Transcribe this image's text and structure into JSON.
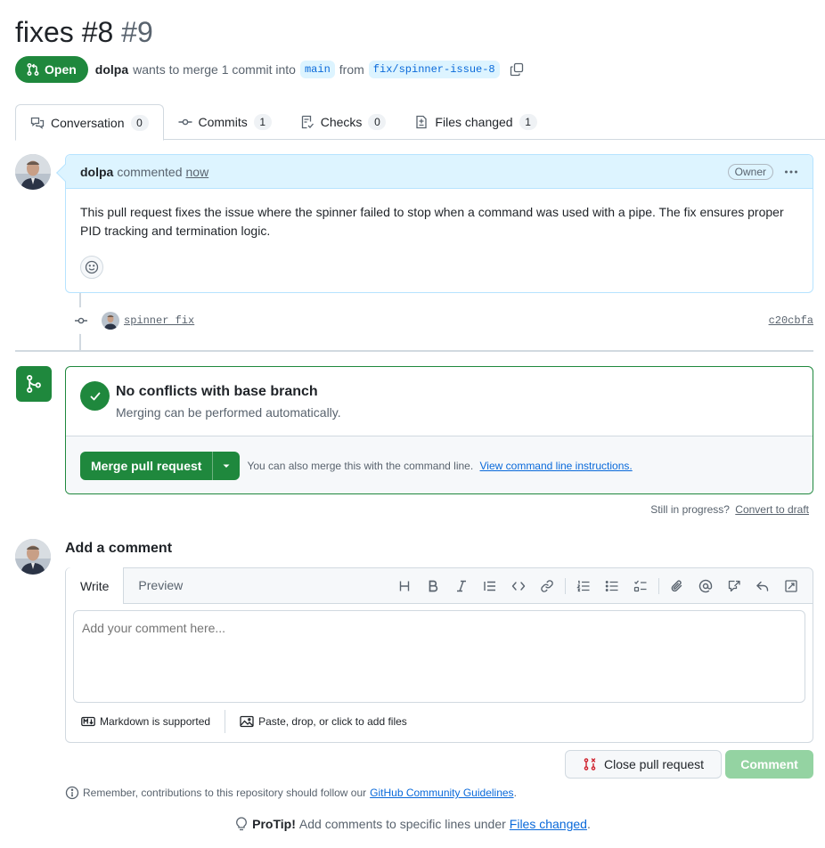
{
  "pr": {
    "title": "fixes #8",
    "number": "#9",
    "status": "Open",
    "author": "dolpa",
    "merge_text_1": "wants to merge 1 commit into",
    "base_branch": "main",
    "merge_text_2": "from",
    "head_branch": "fix/spinner-issue-8"
  },
  "tabs": [
    {
      "label": "Conversation",
      "count": "0"
    },
    {
      "label": "Commits",
      "count": "1"
    },
    {
      "label": "Checks",
      "count": "0"
    },
    {
      "label": "Files changed",
      "count": "1"
    }
  ],
  "comment": {
    "author": "dolpa",
    "action": "commented",
    "time": "now",
    "badge": "Owner",
    "body": "This pull request fixes the issue where the spinner failed to stop when a command was used with a pipe. The fix ensures proper PID tracking and termination logic."
  },
  "commit": {
    "message": "spinner fix",
    "sha": "c20cbfa"
  },
  "merge": {
    "title": "No conflicts with base branch",
    "subtitle": "Merging can be performed automatically.",
    "button": "Merge pull request",
    "hint": "You can also merge this with the command line.",
    "hint_link": "View command line instructions."
  },
  "draft": {
    "text": "Still in progress?",
    "link": "Convert to draft"
  },
  "add_comment": {
    "title": "Add a comment",
    "tab_write": "Write",
    "tab_preview": "Preview",
    "placeholder": "Add your comment here...",
    "markdown_note": "Markdown is supported",
    "files_note": "Paste, drop, or click to add files",
    "close_button": "Close pull request",
    "comment_button": "Comment"
  },
  "footer": {
    "remember": "Remember, contributions to this repository should follow our",
    "guidelines_link": "GitHub Community Guidelines",
    "remember_end": ".",
    "protip_label": "ProTip!",
    "protip_text": "Add comments to specific lines under",
    "protip_link": "Files changed",
    "protip_end": "."
  },
  "colors": {
    "accent_green": "#1f883d",
    "link_blue": "#0969da",
    "comment_header": "#ddf4ff",
    "disabled_green": "#94d3a2",
    "danger_red": "#cf222e"
  }
}
